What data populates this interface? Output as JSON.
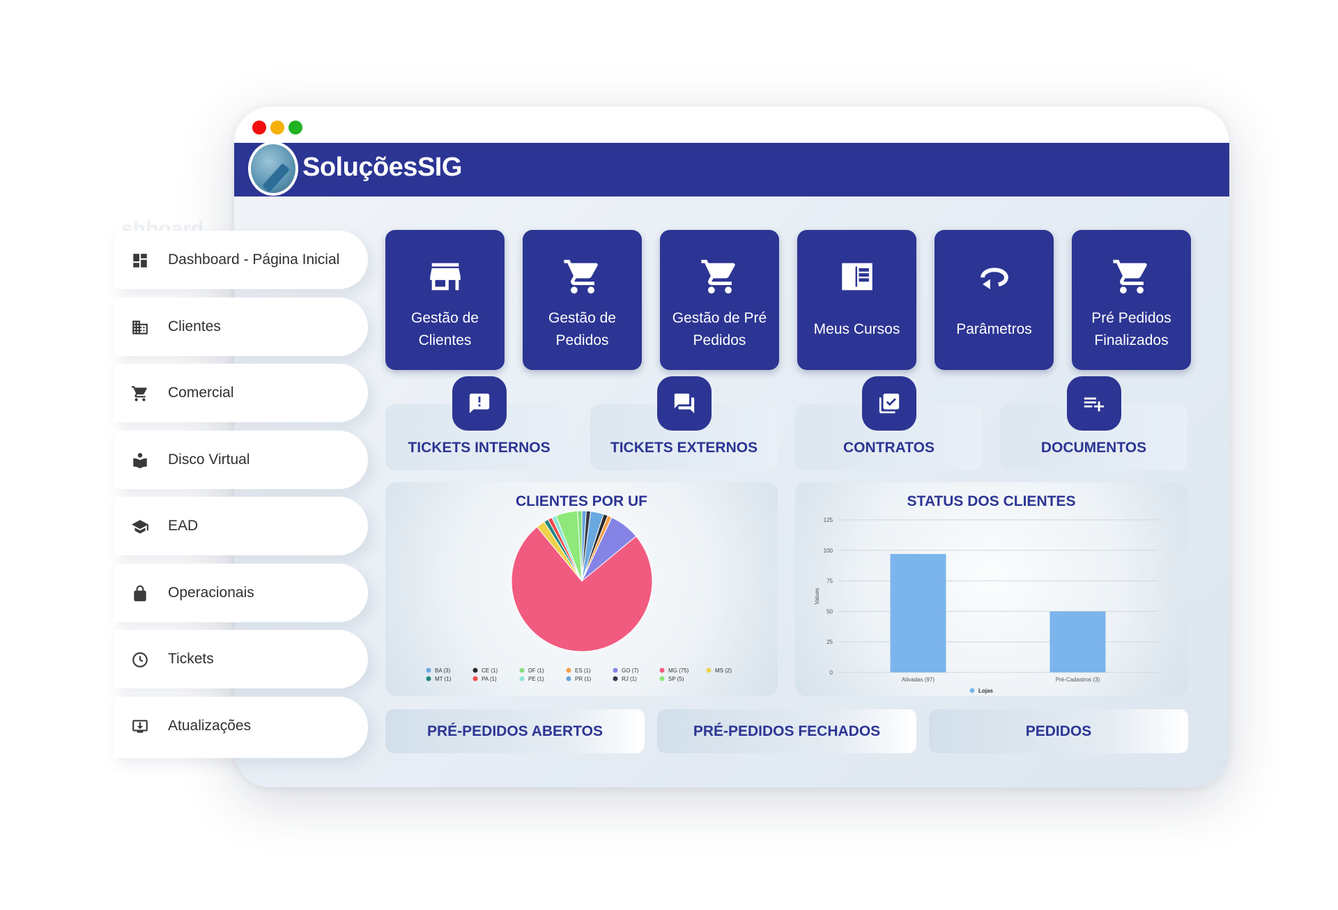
{
  "brand": {
    "name": "SoluçõesSIG"
  },
  "sidebar": {
    "ghost_text": "shboard",
    "items": [
      {
        "label": "Dashboard - Página Inicial",
        "icon": "dashboard-icon"
      },
      {
        "label": "Clientes",
        "icon": "building-icon"
      },
      {
        "label": "Comercial",
        "icon": "cart-icon"
      },
      {
        "label": "Disco Virtual",
        "icon": "book-reader-icon"
      },
      {
        "label": "EAD",
        "icon": "graduation-cap-icon"
      },
      {
        "label": "Operacionais",
        "icon": "lock-icon"
      },
      {
        "label": "Tickets",
        "icon": "clock-icon"
      },
      {
        "label": "Atualizações",
        "icon": "download-icon"
      }
    ]
  },
  "tiles": [
    {
      "label": "Gestão de Clientes",
      "icon": "store-icon"
    },
    {
      "label": "Gestão de Pedidos",
      "icon": "cart-icon"
    },
    {
      "label": "Gestão de Pré Pedidos",
      "icon": "cart-icon"
    },
    {
      "label": "Meus Cursos",
      "icon": "book-icon"
    },
    {
      "label": "Parâmetros",
      "icon": "rotate-icon"
    },
    {
      "label": "Pré Pedidos Finalizados",
      "icon": "cart-icon"
    }
  ],
  "quick_actions": [
    {
      "label": "TICKETS INTERNOS",
      "icon": "alert-message-icon"
    },
    {
      "label": "TICKETS EXTERNOS",
      "icon": "chat-icon"
    },
    {
      "label": "CONTRATOS",
      "icon": "checklist-icon"
    },
    {
      "label": "DOCUMENTOS",
      "icon": "playlist-add-icon"
    }
  ],
  "bottom_buttons": [
    {
      "label": "PRÉ-PEDIDOS ABERTOS"
    },
    {
      "label": "PRÉ-PEDIDOS FECHADOS"
    },
    {
      "label": "PEDIDOS"
    }
  ],
  "chart_data": [
    {
      "type": "pie",
      "title": "CLIENTES POR UF",
      "legend_position": "bottom",
      "slices": [
        {
          "label": "BA (3)",
          "value": 3,
          "color": "#6aa8e0"
        },
        {
          "label": "CE (1)",
          "value": 1,
          "color": "#2a2a2a"
        },
        {
          "label": "DF (1)",
          "value": 1,
          "color": "#86e07a"
        },
        {
          "label": "ES (1)",
          "value": 1,
          "color": "#f5a04a"
        },
        {
          "label": "GO (7)",
          "value": 7,
          "color": "#8584e6"
        },
        {
          "label": "MG (75)",
          "value": 75,
          "color": "#f25b80"
        },
        {
          "label": "MS (2)",
          "value": 2,
          "color": "#eed24a"
        },
        {
          "label": "MT (1)",
          "value": 1,
          "color": "#23857f"
        },
        {
          "label": "PA (1)",
          "value": 1,
          "color": "#ef4d4d"
        },
        {
          "label": "PE (1)",
          "value": 1,
          "color": "#8be6d6"
        },
        {
          "label": "PR (1)",
          "value": 1,
          "color": "#6aa2dc"
        },
        {
          "label": "RJ (1)",
          "value": 1,
          "color": "#343a46"
        },
        {
          "label": "SP (5)",
          "value": 5,
          "color": "#8fe87a"
        }
      ]
    },
    {
      "type": "bar",
      "title": "STATUS DOS CLIENTES",
      "ylabel": "Values",
      "ylim": [
        0,
        125
      ],
      "yticks": [
        "0",
        "25",
        "50",
        "75",
        "100",
        "125"
      ],
      "categories": [
        "Ativadas (97)",
        "Pré-Cadastros (3)"
      ],
      "series": [
        {
          "name": "Lojas",
          "values": [
            97,
            50
          ],
          "color": "#7cb5ec"
        }
      ],
      "grid": true,
      "legend_position": "bottom"
    }
  ]
}
